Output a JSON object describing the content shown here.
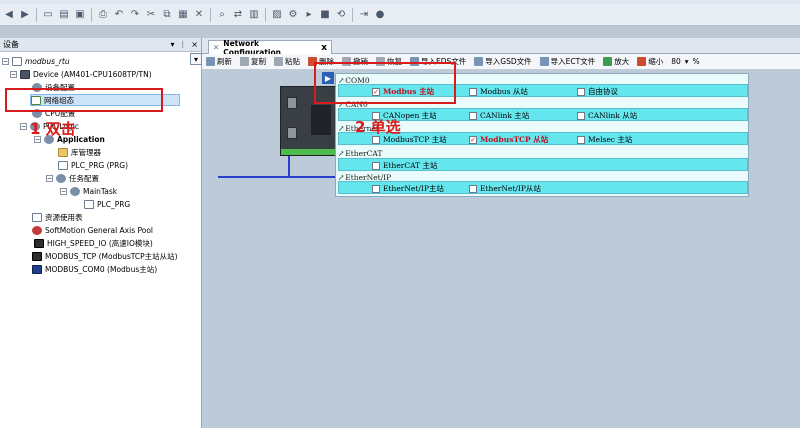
{
  "toolbar": {
    "icons": [
      "back-icon",
      "forward-icon",
      "new-icon",
      "open-icon",
      "save-icon",
      "print-icon",
      "undo-icon",
      "redo-icon",
      "cut-icon",
      "copy-icon",
      "paste-icon",
      "delete-icon",
      "find-icon",
      "replace-icon",
      "build-icon",
      "compile-icon",
      "login-icon",
      "run-icon",
      "stop-icon",
      "reset-icon",
      "step-icon",
      "breakpoint-icon"
    ]
  },
  "devices": {
    "title": "设备",
    "tree": {
      "project": "modbus_rtu",
      "device": "Device (AM401-CPU1608TP/TN)",
      "config": "设备配置",
      "network_config": "网络组态",
      "cpu": "CPU配置",
      "plc_logic": "PLC Logic",
      "application": "Application",
      "library": "库管理器",
      "plc_prg": "PLC_PRG (PRG)",
      "task_config": "任务配置",
      "main_task": "MainTask",
      "plc_prg_call": "PLC_PRG",
      "resources": "资源使用表",
      "softmotion": "SoftMotion General Axis Pool",
      "high_speed_io": "HIGH_SPEED_IO (高速IO模块)",
      "modbus_tcp": "MODBUS_TCP (ModbusTCP主站从站)",
      "modbus_com0": "MODBUS_COM0 (Modbus主站)"
    }
  },
  "editor": {
    "tab_label": "Network Configuration",
    "tab_close": "x",
    "toolbar": {
      "refresh": "刷新",
      "copy": "复制",
      "paste": "粘贴",
      "delete": "删除",
      "undo": "撤销",
      "redo": "恢复",
      "import_eds": "导入EDS文件",
      "import_gsd": "导入GSD文件",
      "import_ect": "导入ECT文件",
      "zoom_in": "放大",
      "zoom_out": "缩小",
      "zoom_value": "80",
      "zoom_unit": "%"
    }
  },
  "protocols": {
    "com0": {
      "header": "COM0",
      "options": [
        {
          "label": "Modbus 主站",
          "checked": true
        },
        {
          "label": "Modbus 从站",
          "checked": false
        },
        {
          "label": "自由协议",
          "checked": false
        }
      ]
    },
    "can0": {
      "header": "CAN0",
      "options": [
        {
          "label": "CANopen 主站",
          "checked": false
        },
        {
          "label": "CANlink 主站",
          "checked": false
        },
        {
          "label": "CANlink 从站",
          "checked": false
        }
      ]
    },
    "ethernet": {
      "header": "Ethernet",
      "options": [
        {
          "label": "ModbusTCP 主站",
          "checked": false
        },
        {
          "label": "ModbusTCP 从站",
          "checked": true
        },
        {
          "label": "Melsec 主站",
          "checked": false
        }
      ]
    },
    "ethercat": {
      "header": "EtherCAT",
      "options": [
        {
          "label": "EtherCAT 主站",
          "checked": false
        }
      ]
    },
    "ethernet_ip": {
      "header": "EtherNet/IP",
      "options": [
        {
          "label": "EtherNet/IP主站",
          "checked": false
        },
        {
          "label": "EtherNet/IP从站",
          "checked": false
        }
      ]
    }
  },
  "annotations": {
    "step1": "1 双击",
    "step2": "2 单选"
  },
  "colors": {
    "annotation_red": "#d81b1b",
    "option_row": "#65e6ef",
    "bus_line": "#2b3fcc"
  }
}
